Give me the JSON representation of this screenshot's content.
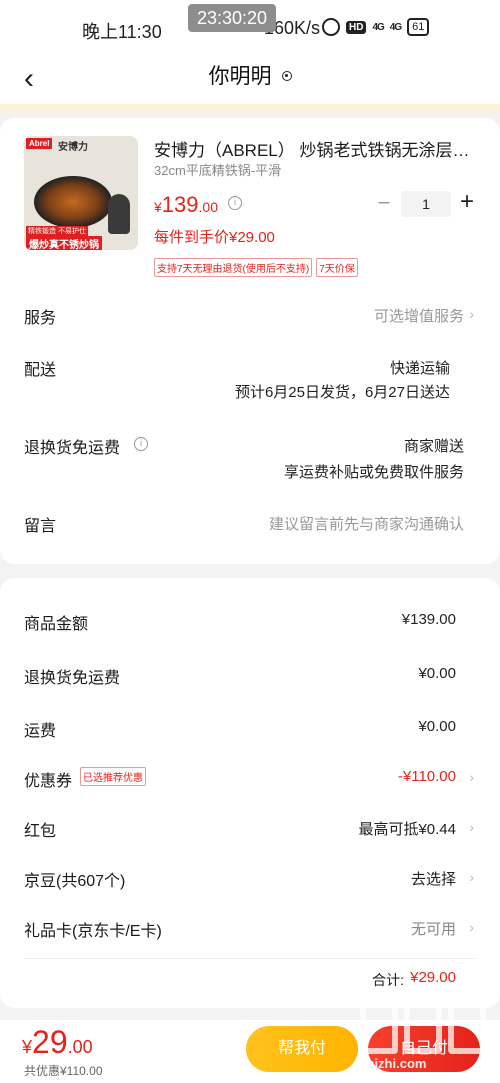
{
  "status_bar": {
    "time": "晚上11:30",
    "clock_overlay": "23:30:20",
    "net_speed": "160K/s",
    "hd": "HD",
    "sig1": "4G",
    "sig2": "4G",
    "battery": "61"
  },
  "header": {
    "title": "你明明"
  },
  "product": {
    "image_brand": "Abrel",
    "image_brand_cn": "安博力",
    "image_tag1": "精铁锻造 不易护仕",
    "image_tag2": "爆炒真不锈炒锅",
    "title": "安博力（ABREL） 炒锅老式铁锅无涂层家…",
    "spec": "32cm平底精铁锅-平滑",
    "price_yen": "¥",
    "price_int": "139",
    "price_dec": ".00",
    "per_price": "每件到手价¥29.00",
    "quantity": "1",
    "badges": [
      "支持7天无理由退货(使用后不支持)",
      "7天价保"
    ]
  },
  "service": {
    "label": "服务",
    "value": "可选增值服务"
  },
  "delivery": {
    "label": "配送",
    "method": "快递运输",
    "estimate": "预计6月25日发货，6月27日送达"
  },
  "return_shipping": {
    "label": "退换货免运费",
    "value1": "商家赠送",
    "value2": "享运费补贴或免费取件服务"
  },
  "message": {
    "label": "留言",
    "placeholder": "建议留言前先与商家沟通确认"
  },
  "pricing": {
    "goods_label": "商品金额",
    "goods_value": "¥139.00",
    "return_label": "退换货免运费",
    "return_value": "¥0.00",
    "shipping_label": "运费",
    "shipping_value": "¥0.00",
    "coupon_label": "优惠券",
    "coupon_badge": "已选推荐优惠",
    "coupon_value": "-¥110.00",
    "redpacket_label": "红包",
    "redpacket_value": "最高可抵¥0.44",
    "jingdou_label": "京豆(共607个)",
    "jingdou_value": "去选择",
    "giftcard_label": "礼品卡(京东卡/E卡)",
    "giftcard_value": "无可用",
    "total_label": "合计:",
    "total_value": "¥29.00"
  },
  "bottom": {
    "price_yen": "¥",
    "price_int": "29",
    "price_dec": ".00",
    "discount": "共优惠¥110.00",
    "help_pay": "帮我付",
    "submit": "自己付"
  },
  "watermark": {
    "url": "zhizhi.com"
  }
}
